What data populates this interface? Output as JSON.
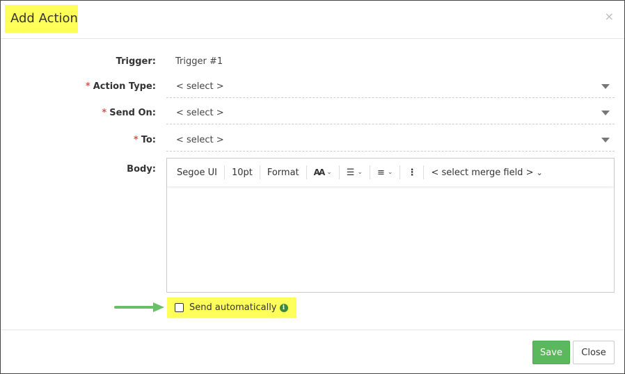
{
  "dialog": {
    "title": "Add Action",
    "close_icon": "×"
  },
  "form": {
    "trigger": {
      "label": "Trigger:",
      "value": "Trigger #1"
    },
    "action_type": {
      "label": "Action Type:",
      "required": "*",
      "value": "< select >"
    },
    "send_on": {
      "label": "Send On:",
      "required": "*",
      "value": "< select >"
    },
    "to": {
      "label": "To:",
      "required": "*",
      "value": "< select >"
    },
    "body": {
      "label": "Body:"
    }
  },
  "toolbar": {
    "font": "Segoe UI",
    "size": "10pt",
    "format": "Format",
    "font_size_icon": "AA",
    "merge_field": "< select merge field >"
  },
  "send_automatically": {
    "label": "Send automatically",
    "checked": false,
    "info_icon": "i"
  },
  "footer": {
    "save": "Save",
    "close": "Close"
  },
  "colors": {
    "highlight": "#ffff5c",
    "save": "#5cb85c",
    "arrow": "#6abf69",
    "required": "#d9534f"
  }
}
